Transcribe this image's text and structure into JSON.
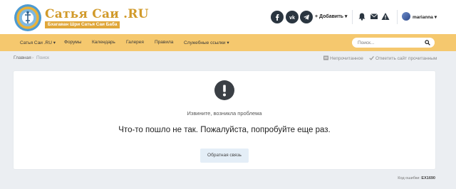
{
  "header": {
    "logo_title": "Сатья Саи .RU",
    "logo_subtitle": "Бхагаван Шри Сатья Саи Баба",
    "social_icons": [
      "facebook-icon",
      "vk-icon",
      "telegram-icon"
    ],
    "add_label": "Добавить ▾",
    "header_icons": [
      "bell-icon",
      "envelope-icon",
      "warning-icon"
    ],
    "username": "marianna ▾"
  },
  "nav": {
    "items": [
      "Сатья Саи .RU ▾",
      "Форумы",
      "Календарь",
      "Галерея",
      "Правила",
      "Служебные ссылки ▾"
    ],
    "search_placeholder": "Поиск..."
  },
  "breadcrumb": {
    "home": "Главная",
    "separator": "›",
    "current": "Поиск",
    "unread": "Непрочитанное",
    "mark_read": "Отметить сайт прочитанным"
  },
  "error": {
    "sorry": "Извините, возникла проблема",
    "message": "Что-то пошло не так. Пожалуйста, попробуйте еще раз.",
    "feedback_button": "Обратная связь",
    "code_label": "Код ошибки:",
    "code": "EX1690"
  },
  "colors": {
    "nav_bg": "#f5c86e",
    "logo_gold": "#d19a2a",
    "page_bg": "#ebeef2",
    "icon_dark": "#2a3540"
  }
}
